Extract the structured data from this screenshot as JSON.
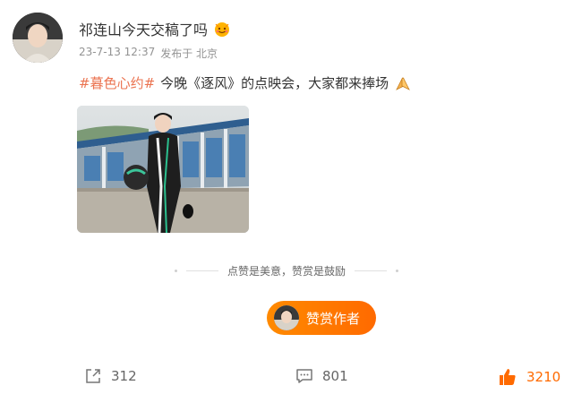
{
  "author": {
    "name": "祁连山今天交稿了吗",
    "sticker_icon": "smiling-face-sticker-icon"
  },
  "meta": {
    "date": "23-7-13 12:37",
    "location": "发布于 北京"
  },
  "post": {
    "hashtag": "#暮色心约#",
    "text": "今晚《逐风》的点映会，大家都来捧场",
    "emoji_icon": "praying-hands-icon"
  },
  "reward": {
    "divider_text": "点赞是美意，赞赏是鼓励",
    "button_label": "赞赏作者"
  },
  "actions": {
    "repost_count": "312",
    "comment_count": "801",
    "like_count": "3210"
  },
  "colors": {
    "accent": "#ff6a00",
    "hashtag": "#eb7350",
    "meta_text": "#939393"
  }
}
